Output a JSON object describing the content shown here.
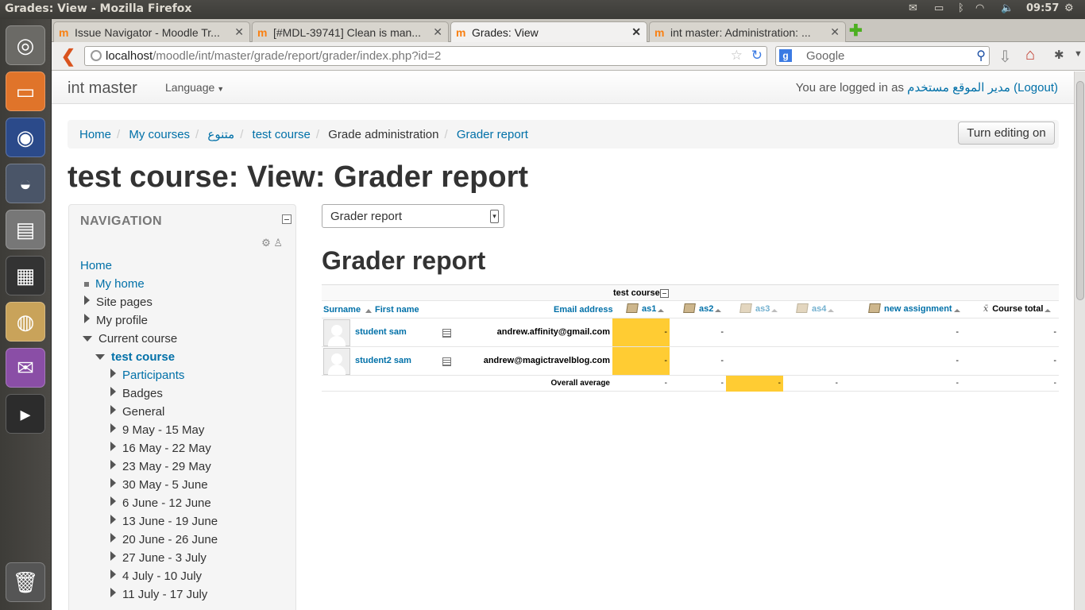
{
  "window_title": "Grades: View - Mozilla Firefox",
  "topbar": {
    "time": "09:57"
  },
  "tabs": [
    {
      "label": "Issue Navigator - Moodle Tr...",
      "favicon": "m"
    },
    {
      "label": "[#MDL-39741] Clean is man...",
      "favicon": "m"
    },
    {
      "label": "Grades: View",
      "favicon": "m"
    },
    {
      "label": "int master: Administration: ...",
      "favicon": "m"
    }
  ],
  "address": {
    "host": "localhost",
    "path": "/moodle/int/master/grade/report/grader/index.php?id=2"
  },
  "search": {
    "placeholder": "Google"
  },
  "navbar": {
    "brand": "int master",
    "language": "Language",
    "logged_in_prefix": "You are logged in as",
    "username": "مدير الموقع مستخدم",
    "logout": "(Logout)"
  },
  "breadcrumb": [
    "Home",
    "My courses",
    "متنوع",
    "test course",
    "Grade administration",
    "Grader report"
  ],
  "edit_button": "Turn editing on",
  "page_title": "test course: View: Grader report",
  "navigation": {
    "header": "NAVIGATION",
    "home": "Home",
    "items": [
      "My home",
      "Site pages",
      "My profile",
      "Current course",
      "test course",
      "Participants",
      "Badges",
      "General",
      "9 May - 15 May",
      "16 May - 22 May",
      "23 May - 29 May",
      "30 May - 5 June",
      "6 June - 12 June",
      "13 June - 19 June",
      "20 June - 26 June",
      "27 June - 3 July",
      "4 July - 10 July",
      "11 July - 17 July"
    ]
  },
  "report_select": "Grader report",
  "report_heading": "Grader report",
  "grader": {
    "category": "test course",
    "headers": {
      "surname": "Surname",
      "firstname": "First name",
      "email": "Email address",
      "items": [
        "as1",
        "as2",
        "as3",
        "as4",
        "new assignment"
      ],
      "total": "Course total"
    },
    "students": [
      {
        "name": "student sam",
        "email": "andrew.affinity@gmail.com",
        "grades": [
          "-",
          "-",
          "",
          "",
          "-"
        ],
        "total": "-"
      },
      {
        "name": "student2 sam",
        "email": "andrew@magictravelblog.com",
        "grades": [
          "-",
          "-",
          "",
          "",
          "-"
        ],
        "total": "-"
      }
    ],
    "average": {
      "label": "Overall average",
      "grades": [
        "-",
        "-",
        "-",
        "-",
        "-"
      ],
      "total": "-"
    }
  },
  "colors": {
    "link": "#0070a8",
    "highlight": "#ffcc33",
    "moodle_orange": "#f98012"
  }
}
